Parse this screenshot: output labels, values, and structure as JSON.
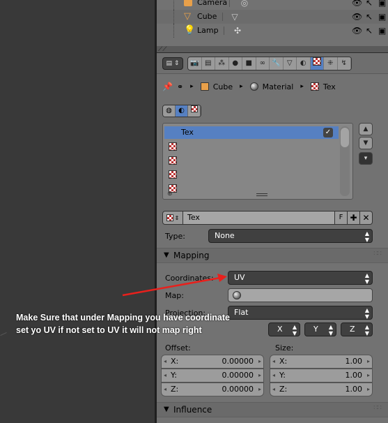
{
  "outliner": {
    "rows": [
      {
        "name": "Camera",
        "icon": "camera-object-icon"
      },
      {
        "name": "Cube",
        "icon": "mesh-object-icon"
      },
      {
        "name": "Lamp",
        "icon": "lamp-object-icon"
      }
    ]
  },
  "header": {
    "editor_type": "properties-editor-icon",
    "tabs": [
      "render",
      "render-layers",
      "scene",
      "world",
      "object",
      "constraints",
      "modifiers",
      "data",
      "material",
      "texture",
      "particles",
      "physics"
    ],
    "active_tab": "texture"
  },
  "breadcrumb": {
    "object": "Cube",
    "material": "Material",
    "texture": "Tex"
  },
  "slots": {
    "items": [
      "Tex",
      "",
      "",
      "",
      ""
    ],
    "selected_index": 0
  },
  "texture_id": {
    "name": "Tex",
    "fake_user": "F"
  },
  "type": {
    "label": "Type:",
    "value": "None"
  },
  "mapping": {
    "title": "Mapping",
    "coordinates_label": "Coordinates:",
    "coordinates_value": "UV",
    "map_label": "Map:",
    "projection_label": "Projection:",
    "projection_value": "Flat",
    "axes": [
      "X",
      "Y",
      "Z"
    ],
    "offset_label": "Offset:",
    "size_label": "Size:",
    "offset": [
      {
        "k": "X:",
        "v": "0.00000"
      },
      {
        "k": "Y:",
        "v": "0.00000"
      },
      {
        "k": "Z:",
        "v": "0.00000"
      }
    ],
    "size": [
      {
        "k": "X:",
        "v": "1.00"
      },
      {
        "k": "Y:",
        "v": "1.00"
      },
      {
        "k": "Z:",
        "v": "1.00"
      }
    ]
  },
  "influence": {
    "title": "Influence"
  },
  "annotation": {
    "line1": "Make Sure that under Mapping you have coordinate",
    "line2": "set yo UV if not set to UV it will not map right",
    "color": "#e8201c"
  }
}
